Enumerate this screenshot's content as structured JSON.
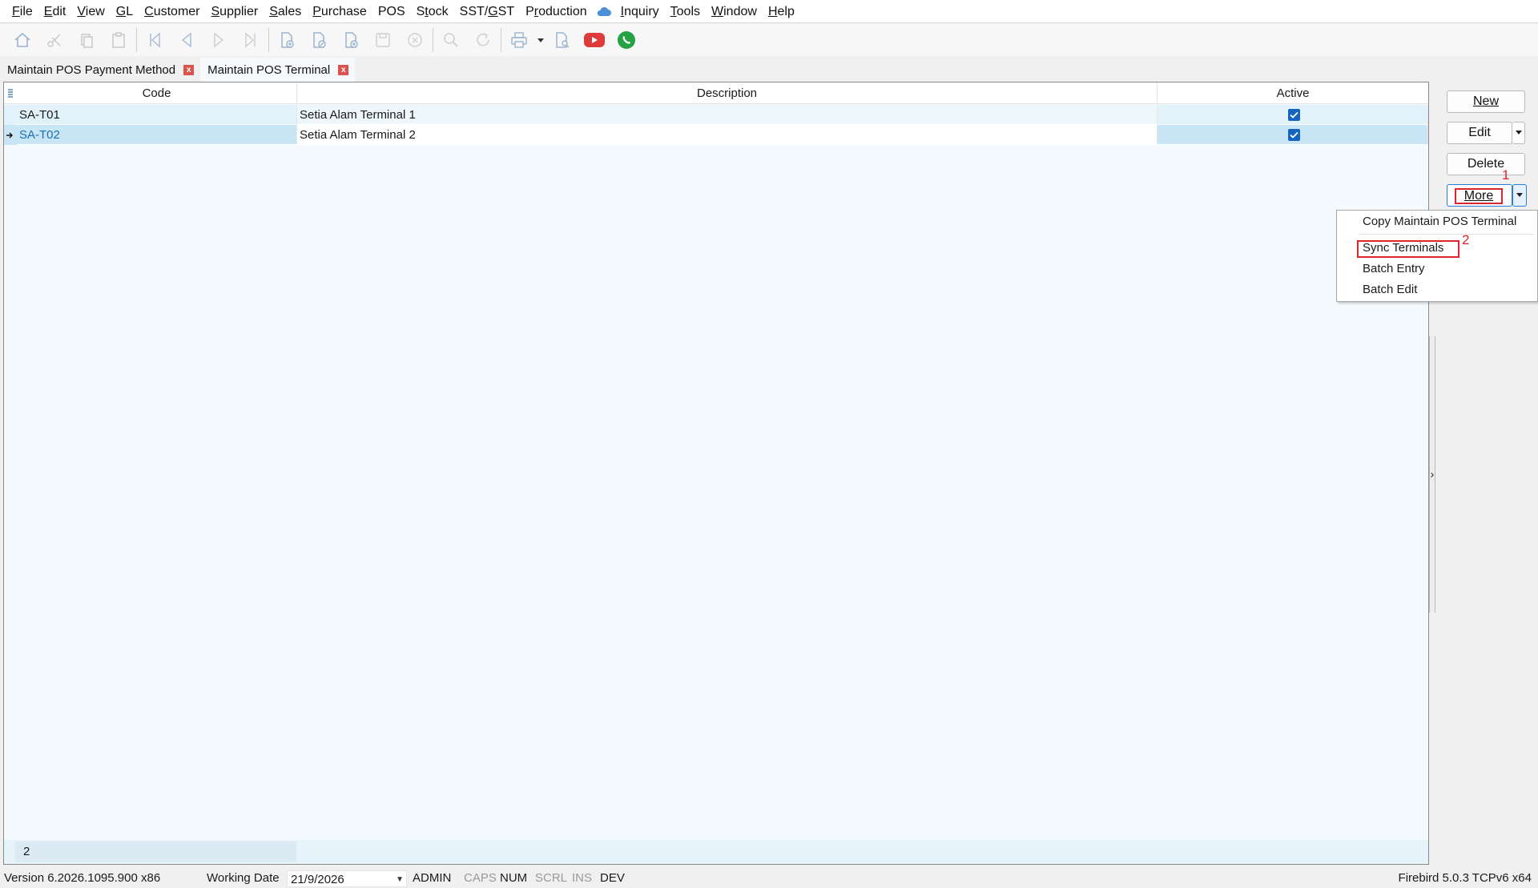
{
  "menu": [
    "File",
    "Edit",
    "View",
    "GL",
    "Customer",
    "Supplier",
    "Sales",
    "Purchase",
    "POS",
    "Stock",
    "SST/GST",
    "Production",
    "Inquiry",
    "Tools",
    "Window",
    "Help"
  ],
  "tabs": [
    {
      "label": "Maintain POS Payment Method",
      "close": "x"
    },
    {
      "label": "Maintain POS Terminal",
      "close": "x"
    }
  ],
  "grid": {
    "columns": [
      "Code",
      "Description",
      "Active"
    ],
    "rows": [
      {
        "code": "SA-T01",
        "description": "Setia Alam Terminal 1",
        "active": true
      },
      {
        "code": "SA-T02",
        "description": "Setia Alam Terminal 2",
        "active": true
      }
    ],
    "record_count": "2"
  },
  "buttons": {
    "new": "New",
    "edit": "Edit",
    "delete": "Delete",
    "more": "More"
  },
  "more_menu": [
    "Copy Maintain POS Terminal",
    "Sync Terminals",
    "Batch Entry",
    "Batch Edit"
  ],
  "annotations": {
    "step1": "1",
    "step2": "2"
  },
  "status": {
    "version": "Version 6.2026.1095.900 x86",
    "working_date_label": "Working Date",
    "working_date": "21/9/2026",
    "user": "ADMIN",
    "caps": "CAPS",
    "num": "NUM",
    "scrl": "SCRL",
    "ins": "INS",
    "dev": "DEV",
    "db": "Firebird 5.0.3 TCPv6 x64"
  },
  "colors": {
    "accent": "#1565c0",
    "highlight_red": "#e0242b",
    "selected_row": "#c9e6f7",
    "grid_bg": "#f4fafd"
  }
}
